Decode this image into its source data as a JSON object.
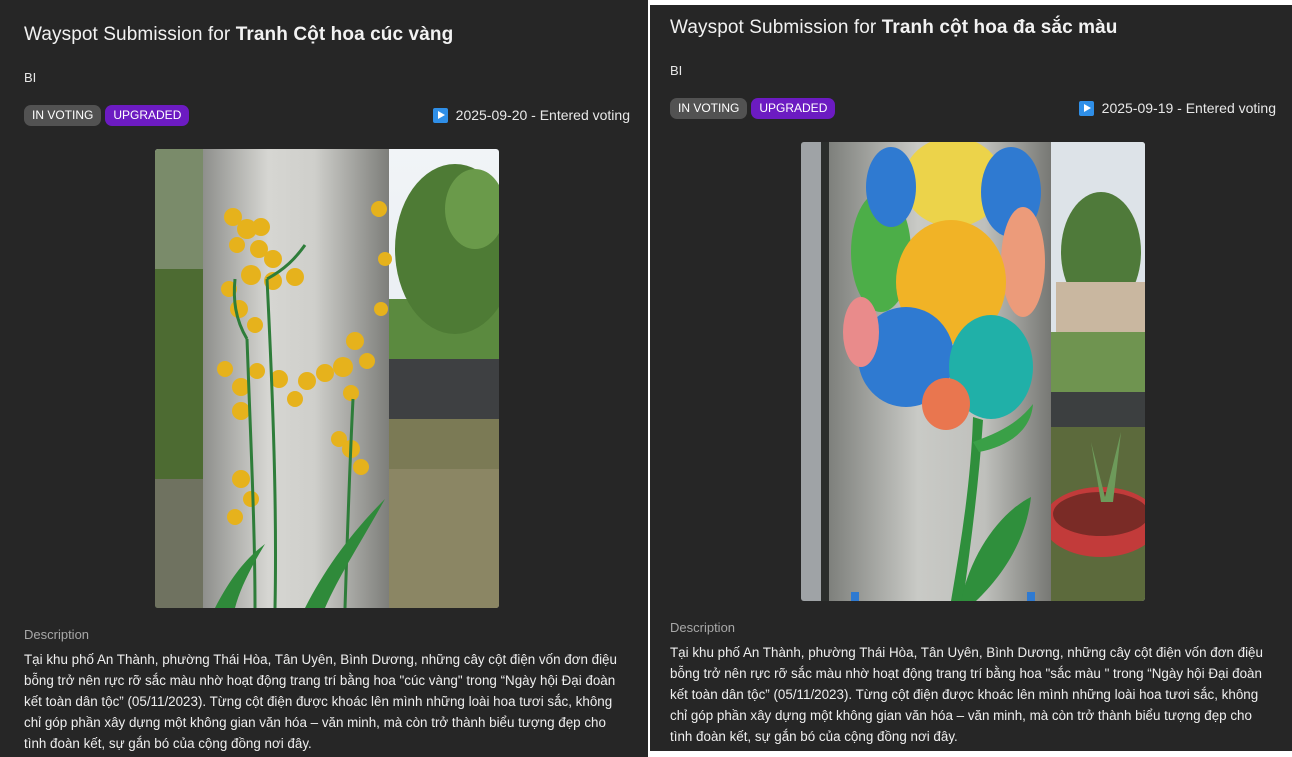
{
  "submissions": [
    {
      "title_prefix": "Wayspot Submission for ",
      "title_name": "Tranh Cột hoa cúc vàng",
      "code": "BI",
      "badges": [
        "IN VOTING",
        "UPGRADED"
      ],
      "status_text": "2025-09-20 - Entered voting",
      "description_label": "Description",
      "description": "Tại khu phố An Thành, phường Thái Hòa, Tân Uyên, Bình Dương, những cây cột điện vốn đơn điệu bỗng trở nên rực rỡ sắc màu nhờ hoạt động trang trí bằng hoa \"cúc vàng\" trong “Ngày hội Đại đoàn kết toàn dân tộc” (05/11/2023). Từng cột điện được khoác lên mình những loài hoa tươi sắc, không chỉ góp phần xây dựng một không gian văn hóa – văn minh, mà còn trở thành biểu tượng đẹp cho tình đoàn kết, sự gắn bó của cộng đồng nơi đây."
    },
    {
      "title_prefix": "Wayspot Submission for ",
      "title_name": "Tranh cột hoa đa sắc màu",
      "code": "BI",
      "badges": [
        "IN VOTING",
        "UPGRADED"
      ],
      "status_text": "2025-09-19 - Entered voting",
      "description_label": "Description",
      "description": "Tại khu phố An Thành, phường Thái Hòa, Tân Uyên, Bình Dương, những cây cột điện vốn đơn điệu bỗng trở nên rực rỡ sắc màu nhờ hoạt động trang trí bằng hoa \"sắc màu \" trong “Ngày hội Đại đoàn kết toàn dân tộc” (05/11/2023). Từng cột điện được khoác lên mình những loài hoa tươi sắc, không chỉ góp phần xây dựng một không gian văn hóa – văn minh, mà còn trở thành biểu tượng đẹp cho tình đoàn kết, sự gắn bó của cộng đồng nơi đây."
    }
  ],
  "colors": {
    "panel_bg": "#262626",
    "badge_voting": "#525252",
    "badge_upgraded": "#6c1bc2",
    "status_icon": "#2f8fe8"
  }
}
